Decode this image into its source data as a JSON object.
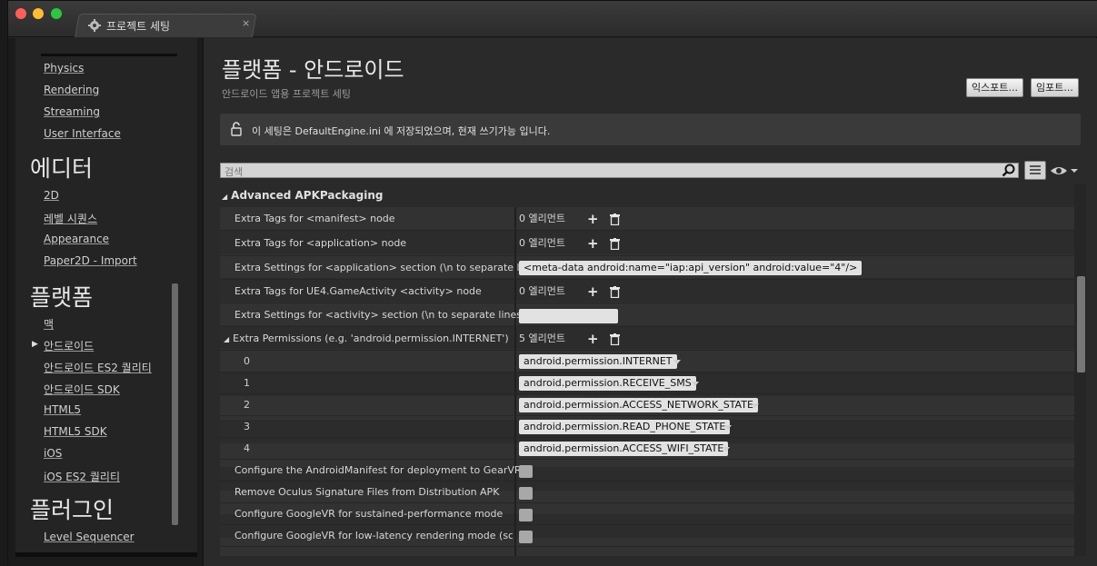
{
  "window": {
    "tab_title": "프로젝트 세팅",
    "tab_close": "×",
    "tab_icon": "gear-icon",
    "traffic_lights": [
      "#ff5f57",
      "#febc2e",
      "#28c840"
    ]
  },
  "sidebar": {
    "items_top": [
      "Physics",
      "Rendering",
      "Streaming",
      "User Interface"
    ],
    "section_editor": "에디터",
    "items_editor": [
      "2D",
      "레벨 시퀀스",
      "Appearance",
      "Paper2D - Import"
    ],
    "section_platform": "플랫폼",
    "items_platform": [
      "맥",
      "안드로이드",
      "안드로이드 ES2 퀄리티",
      "안드로이드 SDK",
      "HTML5",
      "HTML5 SDK",
      "iOS",
      "iOS ES2 퀄리티"
    ],
    "selected_marker": "▶",
    "section_plugin": "플러그인",
    "items_plugin": [
      "Level Sequencer"
    ]
  },
  "header": {
    "title": "플랫폼 - 안드로이드",
    "subtitle": "안드로이드 앱용 프로젝트 세팅",
    "export_label": "익스포트...",
    "import_label": "임포트..."
  },
  "notice": {
    "text": "이 세팅은 DefaultEngine.ini 에 저장되었으며, 현재 쓰기가능 입니다."
  },
  "search": {
    "placeholder": "검색"
  },
  "category": {
    "title": "Advanced APKPackaging",
    "arrow": "◢"
  },
  "rows": [
    {
      "label": "Extra Tags for <manifest> node",
      "value": "0 엘리먼트"
    },
    {
      "label": "Extra Tags for <application> node",
      "value": "0 엘리먼트"
    },
    {
      "label": "Extra Settings for <application> section (\\n to separate lines)",
      "value": "<meta-data android:name=\"iap:api_version\" android:value=\"4\"/>"
    },
    {
      "label": "Extra Tags for UE4.GameActivity <activity> node",
      "value": "0 엘리먼트"
    },
    {
      "label": "Extra Settings for <activity> section (\\n to separate lines)",
      "value": ""
    },
    {
      "label": "Extra Permissions (e.g. 'android.permission.INTERNET')",
      "value": "5 엘리먼트"
    }
  ],
  "permissions": [
    {
      "index": "0",
      "value": "android.permission.INTERNET"
    },
    {
      "index": "1",
      "value": "android.permission.RECEIVE_SMS"
    },
    {
      "index": "2",
      "value": "android.permission.ACCESS_NETWORK_STATE"
    },
    {
      "index": "3",
      "value": "android.permission.READ_PHONE_STATE"
    },
    {
      "index": "4",
      "value": "android.permission.ACCESS_WIFI_STATE"
    }
  ],
  "checkbox_rows": [
    {
      "label": "Configure the AndroidManifest for deployment to GearVR",
      "checked": false
    },
    {
      "label": "Remove Oculus Signature Files from Distribution APK",
      "checked": false
    },
    {
      "label": "Configure GoogleVR for sustained-performance mode",
      "checked": false
    },
    {
      "label": "Configure GoogleVR for low-latency rendering mode (scanline",
      "checked": false
    }
  ],
  "plus": "+"
}
